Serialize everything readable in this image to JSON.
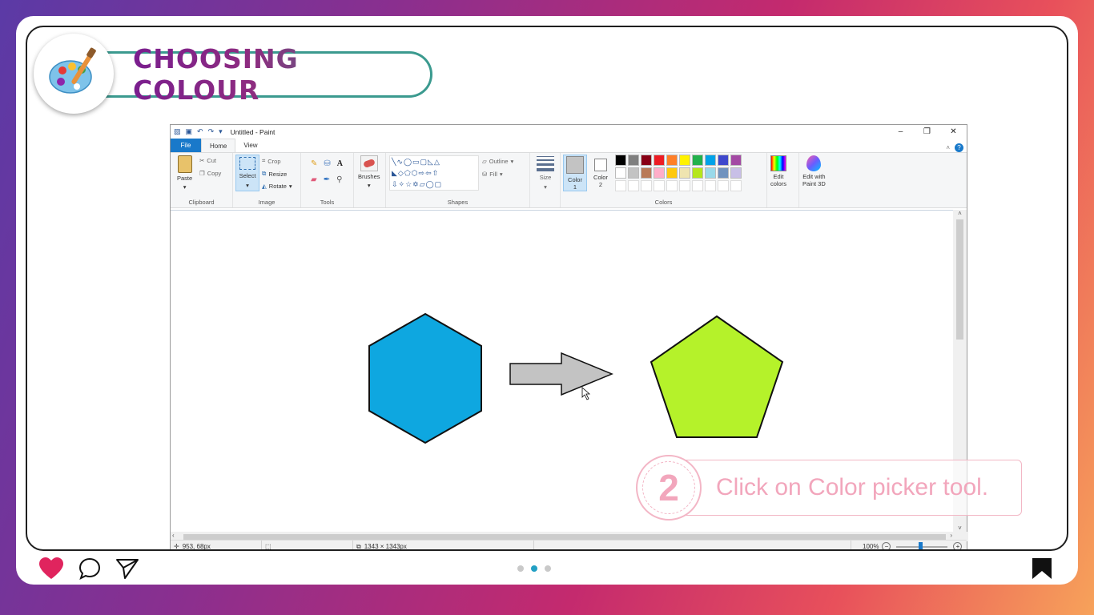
{
  "slide": {
    "title": "CHOOSING COLOUR",
    "step_number": "2",
    "step_text": "Click on Color picker tool."
  },
  "paint": {
    "window_title": "Untitled - Paint",
    "tabs": [
      "File",
      "Home",
      "View"
    ],
    "active_tab": "Home",
    "clipboard": {
      "paste": "Paste",
      "cut": "Cut",
      "copy": "Copy",
      "label": "Clipboard"
    },
    "image": {
      "select": "Select",
      "crop": "Crop",
      "resize": "Resize",
      "rotate": "Rotate",
      "label": "Image"
    },
    "tools_label": "Tools",
    "brushes": "Brushes",
    "shapes": {
      "outline": "Outline",
      "fill": "Fill",
      "label": "Shapes"
    },
    "size": "Size",
    "color1": "Color\n1",
    "color2": "Color\n2",
    "colors_label": "Colors",
    "edit_colors": "Edit\ncolors",
    "edit_paint3d": "Edit with\nPaint 3D",
    "palette_row1": [
      "#000000",
      "#7f7f7f",
      "#880015",
      "#ed1c24",
      "#ff7f27",
      "#fff200",
      "#22b14c",
      "#00a2e8",
      "#3f48cc",
      "#a349a4"
    ],
    "palette_row2": [
      "#ffffff",
      "#c3c3c3",
      "#b97a57",
      "#ffaec9",
      "#ffc90e",
      "#efe4b0",
      "#b5e61d",
      "#99d9ea",
      "#7092be",
      "#c8bfe7"
    ],
    "palette_row3": [
      "#ffffff",
      "#ffffff",
      "#ffffff",
      "#ffffff",
      "#ffffff",
      "#ffffff",
      "#ffffff",
      "#ffffff",
      "#ffffff",
      "#ffffff"
    ],
    "status": {
      "cursor_pos": "953, 68px",
      "canvas_size": "1343 × 1343px",
      "zoom": "100%"
    },
    "canvas_colors": {
      "hexagon": "#0ea7e0",
      "arrow": "#c3c3c3",
      "pentagon": "#b5f22a"
    }
  },
  "footer": {
    "like_color": "#e0245e"
  }
}
